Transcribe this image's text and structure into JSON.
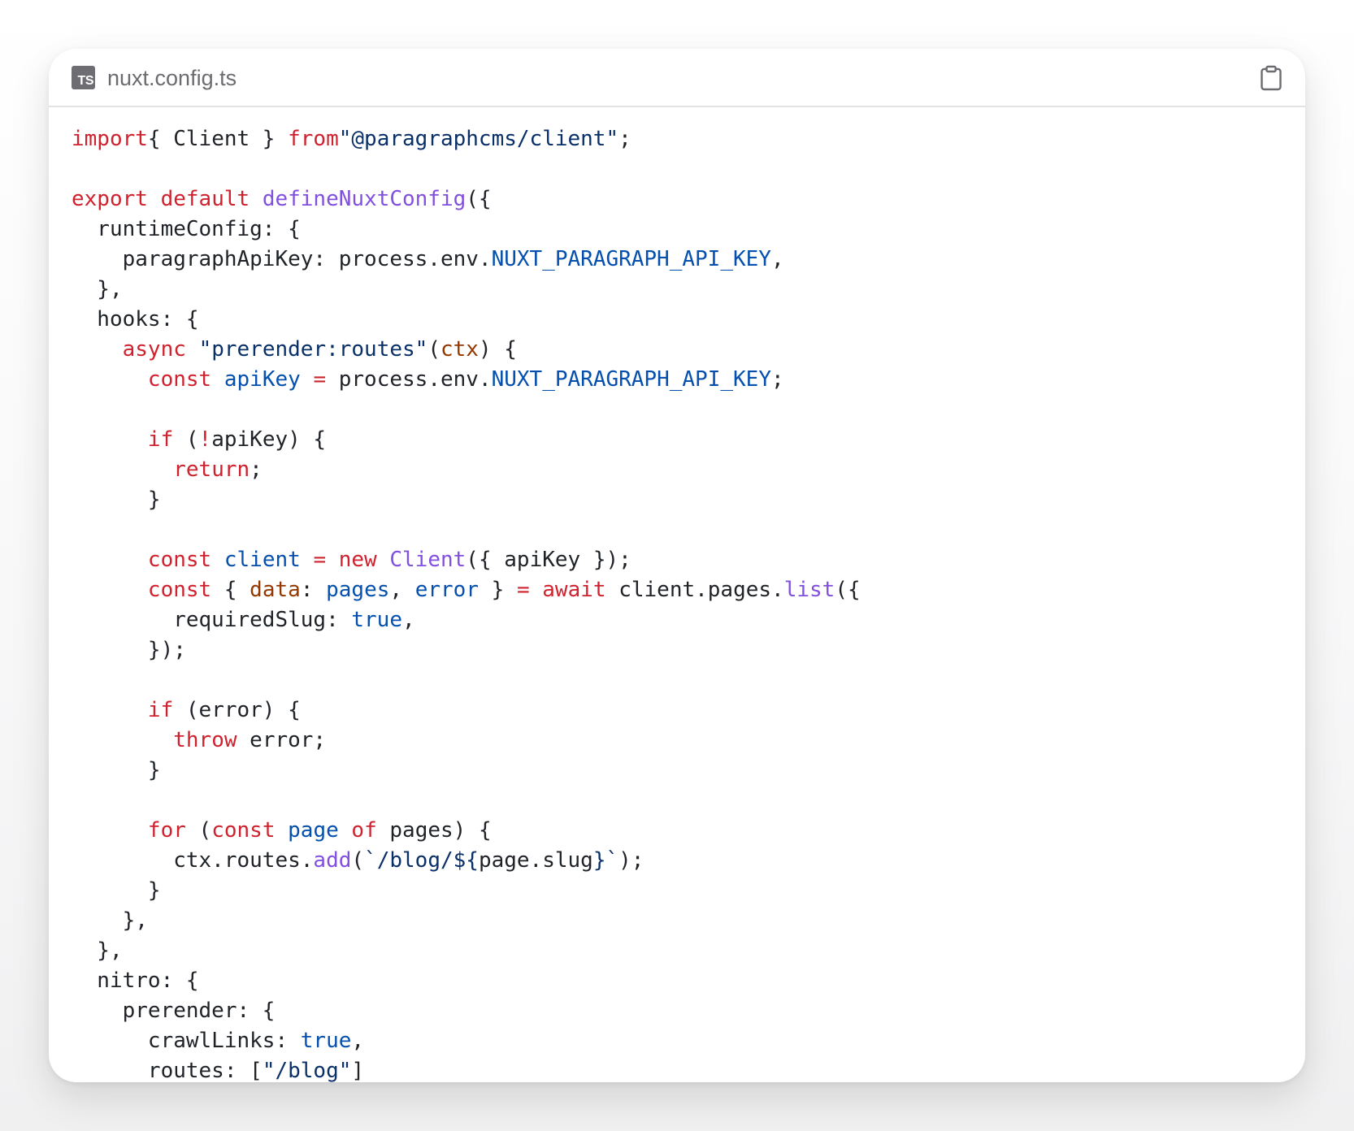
{
  "window": {
    "filename": "nuxt.config.ts",
    "file_type_badge": "TS",
    "copy_icon": "clipboard-icon"
  },
  "colors": {
    "keyword": "#cf222e",
    "function": "#8250df",
    "string": "#0a3069",
    "constant": "#0550ae",
    "parameter": "#953800",
    "plain": "#1f2328"
  },
  "code": {
    "language": "typescript",
    "lines": [
      [
        [
          "kw",
          "import"
        ],
        [
          "",
          "{ Client } "
        ],
        [
          "kw",
          "from"
        ],
        [
          "",
          ""
        ],
        [
          "str",
          "\"@paragraphcms/client\""
        ],
        [
          "",
          ";"
        ]
      ],
      [],
      [
        [
          "kw",
          "export"
        ],
        [
          "",
          " "
        ],
        [
          "kw",
          "default"
        ],
        [
          "",
          " "
        ],
        [
          "fn",
          "defineNuxtConfig"
        ],
        [
          "",
          "({"
        ]
      ],
      [
        [
          "",
          "  runtimeConfig: {"
        ]
      ],
      [
        [
          "",
          "    paragraphApiKey: process.env."
        ],
        [
          "con",
          "NUXT_PARAGRAPH_API_KEY"
        ],
        [
          "",
          ","
        ]
      ],
      [
        [
          "",
          "  },"
        ]
      ],
      [
        [
          "",
          "  hooks: {"
        ]
      ],
      [
        [
          "",
          "    "
        ],
        [
          "kw",
          "async"
        ],
        [
          "",
          " "
        ],
        [
          "str",
          "\"prerender:routes\""
        ],
        [
          "",
          "("
        ],
        [
          "var",
          "ctx"
        ],
        [
          "",
          ") {"
        ]
      ],
      [
        [
          "",
          "      "
        ],
        [
          "kw",
          "const"
        ],
        [
          "",
          " "
        ],
        [
          "con",
          "apiKey"
        ],
        [
          "",
          " "
        ],
        [
          "kw",
          "="
        ],
        [
          "",
          " process.env."
        ],
        [
          "con",
          "NUXT_PARAGRAPH_API_KEY"
        ],
        [
          "",
          ";"
        ]
      ],
      [],
      [
        [
          "",
          "      "
        ],
        [
          "kw",
          "if"
        ],
        [
          "",
          " ("
        ],
        [
          "kw",
          "!"
        ],
        [
          "",
          "apiKey) {"
        ]
      ],
      [
        [
          "",
          "        "
        ],
        [
          "kw",
          "return"
        ],
        [
          "",
          ";"
        ]
      ],
      [
        [
          "",
          "      }"
        ]
      ],
      [],
      [
        [
          "",
          "      "
        ],
        [
          "kw",
          "const"
        ],
        [
          "",
          " "
        ],
        [
          "con",
          "client"
        ],
        [
          "",
          " "
        ],
        [
          "kw",
          "="
        ],
        [
          "",
          " "
        ],
        [
          "kw",
          "new"
        ],
        [
          "",
          " "
        ],
        [
          "fn",
          "Client"
        ],
        [
          "",
          "({ apiKey });"
        ]
      ],
      [
        [
          "",
          "      "
        ],
        [
          "kw",
          "const"
        ],
        [
          "",
          " { "
        ],
        [
          "var",
          "data"
        ],
        [
          "",
          ": "
        ],
        [
          "con",
          "pages"
        ],
        [
          "",
          ", "
        ],
        [
          "con",
          "error"
        ],
        [
          "",
          " } "
        ],
        [
          "kw",
          "="
        ],
        [
          "",
          " "
        ],
        [
          "kw",
          "await"
        ],
        [
          "",
          " client.pages."
        ],
        [
          "fn",
          "list"
        ],
        [
          "",
          "({"
        ]
      ],
      [
        [
          "",
          "        requiredSlug: "
        ],
        [
          "con",
          "true"
        ],
        [
          "",
          ","
        ]
      ],
      [
        [
          "",
          "      });"
        ]
      ],
      [],
      [
        [
          "",
          "      "
        ],
        [
          "kw",
          "if"
        ],
        [
          "",
          " (error) {"
        ]
      ],
      [
        [
          "",
          "        "
        ],
        [
          "kw",
          "throw"
        ],
        [
          "",
          " error;"
        ]
      ],
      [
        [
          "",
          "      }"
        ]
      ],
      [],
      [
        [
          "",
          "      "
        ],
        [
          "kw",
          "for"
        ],
        [
          "",
          " ("
        ],
        [
          "kw",
          "const"
        ],
        [
          "",
          " "
        ],
        [
          "con",
          "page"
        ],
        [
          "",
          " "
        ],
        [
          "kw",
          "of"
        ],
        [
          "",
          " pages) {"
        ]
      ],
      [
        [
          "",
          "        ctx.routes."
        ],
        [
          "fn",
          "add"
        ],
        [
          "",
          "("
        ],
        [
          "str",
          "`/blog/${"
        ],
        [
          "",
          "page.slug"
        ],
        [
          "str",
          "}`"
        ],
        [
          "",
          ");"
        ]
      ],
      [
        [
          "",
          "      }"
        ]
      ],
      [
        [
          "",
          "    },"
        ]
      ],
      [
        [
          "",
          "  },"
        ]
      ],
      [
        [
          "",
          "  nitro: {"
        ]
      ],
      [
        [
          "",
          "    prerender: {"
        ]
      ],
      [
        [
          "",
          "      crawlLinks: "
        ],
        [
          "con",
          "true"
        ],
        [
          "",
          ","
        ]
      ],
      [
        [
          "",
          "      routes: ["
        ],
        [
          "str",
          "\"/blog\""
        ],
        [
          "",
          "]"
        ]
      ]
    ]
  }
}
